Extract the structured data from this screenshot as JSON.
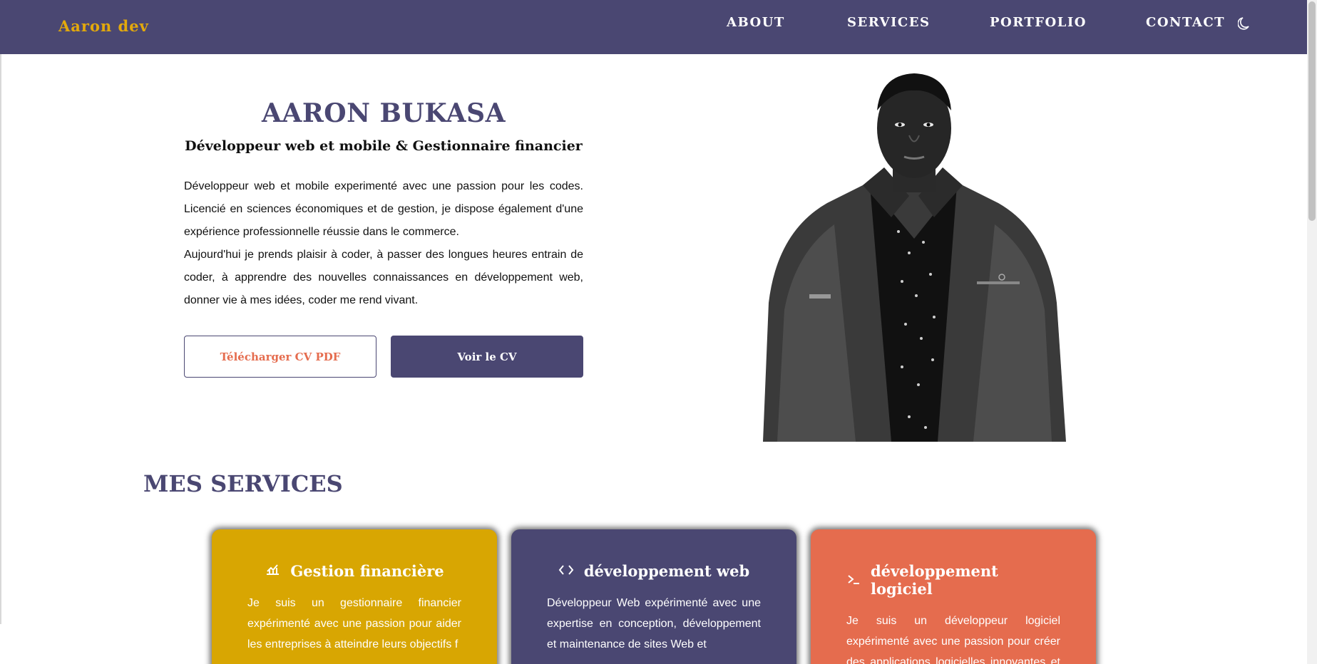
{
  "nav": {
    "brand": "Aaron dev",
    "links": [
      "ABOUT",
      "SERVICES",
      "PORTFOLIO",
      "CONTACT"
    ],
    "theme_icon": "moon-icon"
  },
  "hero": {
    "name": "AARON BUKASA",
    "role": "Développeur web et mobile & Gestionnaire financier",
    "paragraph1": "Développeur web et mobile experimenté avec une passion pour les codes. Licencié en sciences économiques et de gestion, je dispose également d'une expérience professionnelle réussie dans le commerce.",
    "paragraph2": "Aujourd'hui je prends plaisir à coder, à passer des longues heures entrain de coder, à apprendre des nouvelles connaissances en développement web, donner vie à mes idées, coder me rend vivant.",
    "btn_download": "Télécharger CV PDF",
    "btn_view": "Voir le CV"
  },
  "services": {
    "title": "MES SERVICES",
    "cards": [
      {
        "icon": "finance-chart-icon",
        "title": "Gestion financière",
        "text": "Je suis un gestionnaire financier expérimenté avec une passion pour aider les entreprises à atteindre leurs objectifs f",
        "color": "#d8a602"
      },
      {
        "icon": "code-icon",
        "title": "développement web",
        "text": "Développeur Web expérimenté avec une expertise en conception, développement et maintenance de sites Web et",
        "color": "#4a4772"
      },
      {
        "icon": "terminal-icon",
        "title": "développement logiciel",
        "text": "Je suis un développeur logiciel expérimenté avec une passion pour créer des applications logicielles innovantes et e",
        "color": "#e56c4e"
      }
    ]
  },
  "colors": {
    "primary": "#4a4772",
    "accent_gold": "#e3a90c",
    "accent_orange": "#e56c4e"
  }
}
